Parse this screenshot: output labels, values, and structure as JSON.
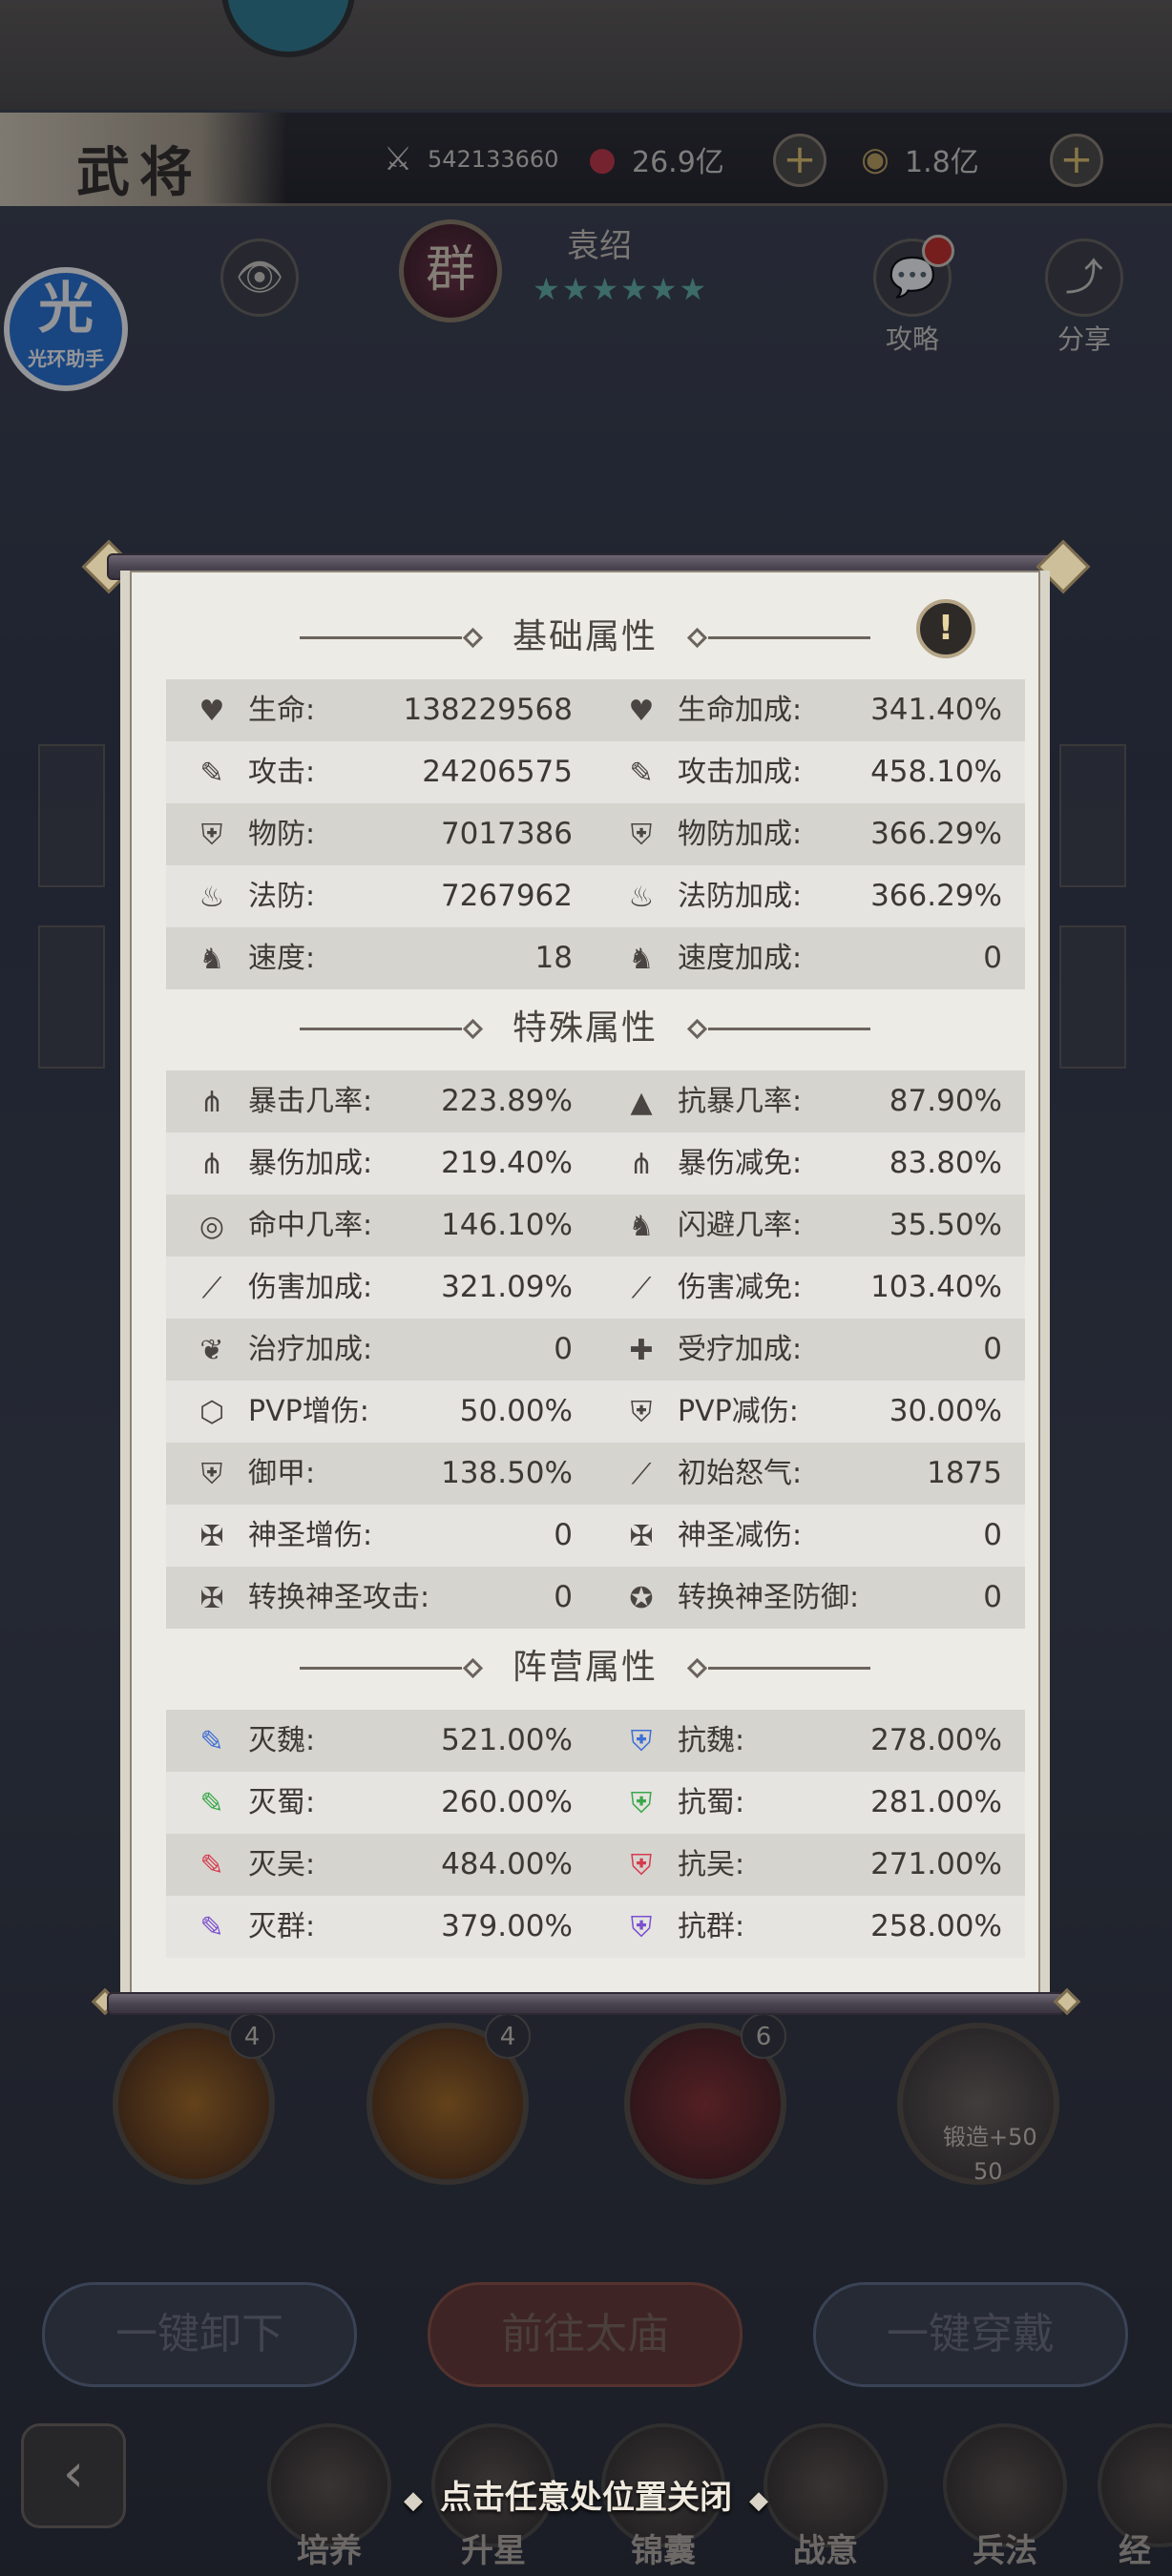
{
  "header": {
    "title": "武将",
    "power": "542133660",
    "gold": "26.9亿",
    "coins": "1.8亿",
    "plus": "+"
  },
  "hero": {
    "faction_char": "群",
    "name": "袁绍",
    "stars": "★★★★★★"
  },
  "helper_badge": {
    "big": "光",
    "label": "光环助手"
  },
  "side_buttons": {
    "strategy": "攻略",
    "share": "分享"
  },
  "skills": {
    "counts": [
      "4",
      "4",
      "6"
    ],
    "forge_label": "锻造+50",
    "forge_level": "50"
  },
  "bottom_actions": {
    "unequip_all": "一键卸下",
    "goto_temple": "前往太庙",
    "equip_all": "一键穿戴"
  },
  "tabs": [
    "培养",
    "升星",
    "锦囊",
    "战意",
    "兵法",
    "经"
  ],
  "close_hint": "点击任意处位置关闭",
  "modal": {
    "sections": {
      "basic": "基础属性",
      "special": "特殊属性",
      "faction": "阵营属性"
    },
    "info_icon": "!",
    "basic_rows": [
      {
        "l_icon": "heart-icon",
        "l_name": "生命:",
        "l_val": "138229568",
        "r_icon": "heart-plus-icon",
        "r_name": "生命加成:",
        "r_val": "341.40%"
      },
      {
        "l_icon": "sword-icon",
        "l_name": "攻击:",
        "l_val": "24206575",
        "r_icon": "sword-icon",
        "r_name": "攻击加成:",
        "r_val": "458.10%"
      },
      {
        "l_icon": "shield-icon",
        "l_name": "物防:",
        "l_val": "7017386",
        "r_icon": "shield-icon",
        "r_name": "物防加成:",
        "r_val": "366.29%"
      },
      {
        "l_icon": "flame-icon",
        "l_name": "法防:",
        "l_val": "7267962",
        "r_icon": "flame-icon",
        "r_name": "法防加成:",
        "r_val": "366.29%"
      },
      {
        "l_icon": "runner-icon",
        "l_name": "速度:",
        "l_val": "18",
        "r_icon": "runner-icon",
        "r_name": "速度加成:",
        "r_val": "0"
      }
    ],
    "special_rows": [
      {
        "l_icon": "claw-icon",
        "l_name": "暴击几率:",
        "l_val": "223.89%",
        "r_icon": "anti-crit-icon",
        "r_name": "抗暴几率:",
        "r_val": "87.90%"
      },
      {
        "l_icon": "claw-icon",
        "l_name": "暴伤加成:",
        "l_val": "219.40%",
        "r_icon": "claw-icon",
        "r_name": "暴伤减免:",
        "r_val": "83.80%"
      },
      {
        "l_icon": "target-icon",
        "l_name": "命中几率:",
        "l_val": "146.10%",
        "r_icon": "runner-icon",
        "r_name": "闪避几率:",
        "r_val": "35.50%"
      },
      {
        "l_icon": "slash-icon",
        "l_name": "伤害加成:",
        "l_val": "321.09%",
        "r_icon": "slash-icon",
        "r_name": "伤害减免:",
        "r_val": "103.40%"
      },
      {
        "l_icon": "leaf-icon",
        "l_name": "治疗加成:",
        "l_val": "0",
        "r_icon": "heal-icon",
        "r_name": "受疗加成:",
        "r_val": "0"
      },
      {
        "l_icon": "pvp-shield-icon",
        "l_name": "PVP增伤:",
        "l_val": "50.00%",
        "r_icon": "shield-icon",
        "r_name": "PVP减伤:",
        "r_val": "30.00%"
      },
      {
        "l_icon": "shield-icon",
        "l_name": "御甲:",
        "l_val": "138.50%",
        "r_icon": "slash-icon",
        "r_name": "初始怒气:",
        "r_val": "1875"
      },
      {
        "l_icon": "holy-icon",
        "l_name": "神圣增伤:",
        "l_val": "0",
        "r_icon": "holy-icon",
        "r_name": "神圣减伤:",
        "r_val": "0"
      },
      {
        "l_icon": "holy-icon",
        "l_name": "转换神圣攻击:",
        "l_val": "0",
        "r_icon": "holy-shield-icon",
        "r_name": "转换神圣防御:",
        "r_val": "0"
      }
    ],
    "faction_rows": [
      {
        "l_icon": "wei-sword-icon",
        "l_color": "#3f6fd6",
        "l_name": "灭魏:",
        "l_val": "521.00%",
        "r_icon": "wei-shield-icon",
        "r_color": "#3f6fd6",
        "r_name": "抗魏:",
        "r_val": "278.00%"
      },
      {
        "l_icon": "shu-sword-icon",
        "l_color": "#3aa84a",
        "l_name": "灭蜀:",
        "l_val": "260.00%",
        "r_icon": "shu-shield-icon",
        "r_color": "#3aa84a",
        "r_name": "抗蜀:",
        "r_val": "281.00%"
      },
      {
        "l_icon": "wu-sword-icon",
        "l_color": "#d63b4f",
        "l_name": "灭吴:",
        "l_val": "484.00%",
        "r_icon": "wu-shield-icon",
        "r_color": "#d63b4f",
        "r_name": "抗吴:",
        "r_val": "271.00%"
      },
      {
        "l_icon": "qun-sword-icon",
        "l_color": "#7a4fd0",
        "l_name": "灭群:",
        "l_val": "379.00%",
        "r_icon": "qun-shield-icon",
        "r_color": "#7a4fd0",
        "r_name": "抗群:",
        "r_val": "258.00%"
      }
    ]
  }
}
